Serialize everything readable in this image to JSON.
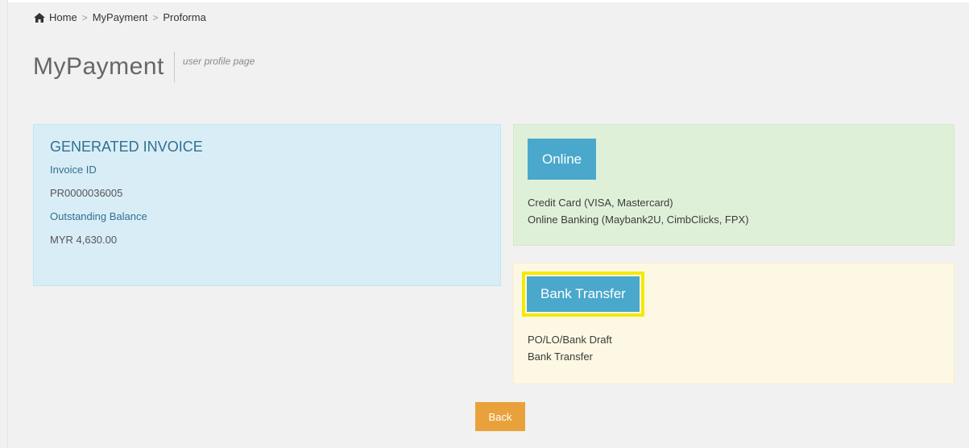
{
  "breadcrumb": {
    "items": [
      "Home",
      "MyPayment",
      "Proforma"
    ],
    "separator": ">"
  },
  "page": {
    "title": "MyPayment",
    "subtitle": "user profile page"
  },
  "invoice": {
    "heading": "GENERATED INVOICE",
    "id_label": "Invoice ID",
    "id_value": "PR0000036005",
    "balance_label": "Outstanding Balance",
    "balance_value": "MYR 4,630.00"
  },
  "online": {
    "button_label": "Online",
    "options": [
      "Credit Card (VISA, Mastercard)",
      "Online Banking (Maybank2U, CimbClicks, FPX)"
    ]
  },
  "bank": {
    "button_label": "Bank Transfer",
    "options": [
      "PO/LO/Bank Draft",
      "Bank Transfer"
    ]
  },
  "actions": {
    "back_label": "Back"
  },
  "colors": {
    "info_button": "#49a8cc",
    "back_button": "#e9a23b",
    "invoice_panel": "#d9edf7",
    "online_panel": "#dff0d8",
    "bank_panel": "#fcf8e3",
    "highlight": "#f5e900"
  },
  "icons": {
    "home": "home-icon"
  }
}
